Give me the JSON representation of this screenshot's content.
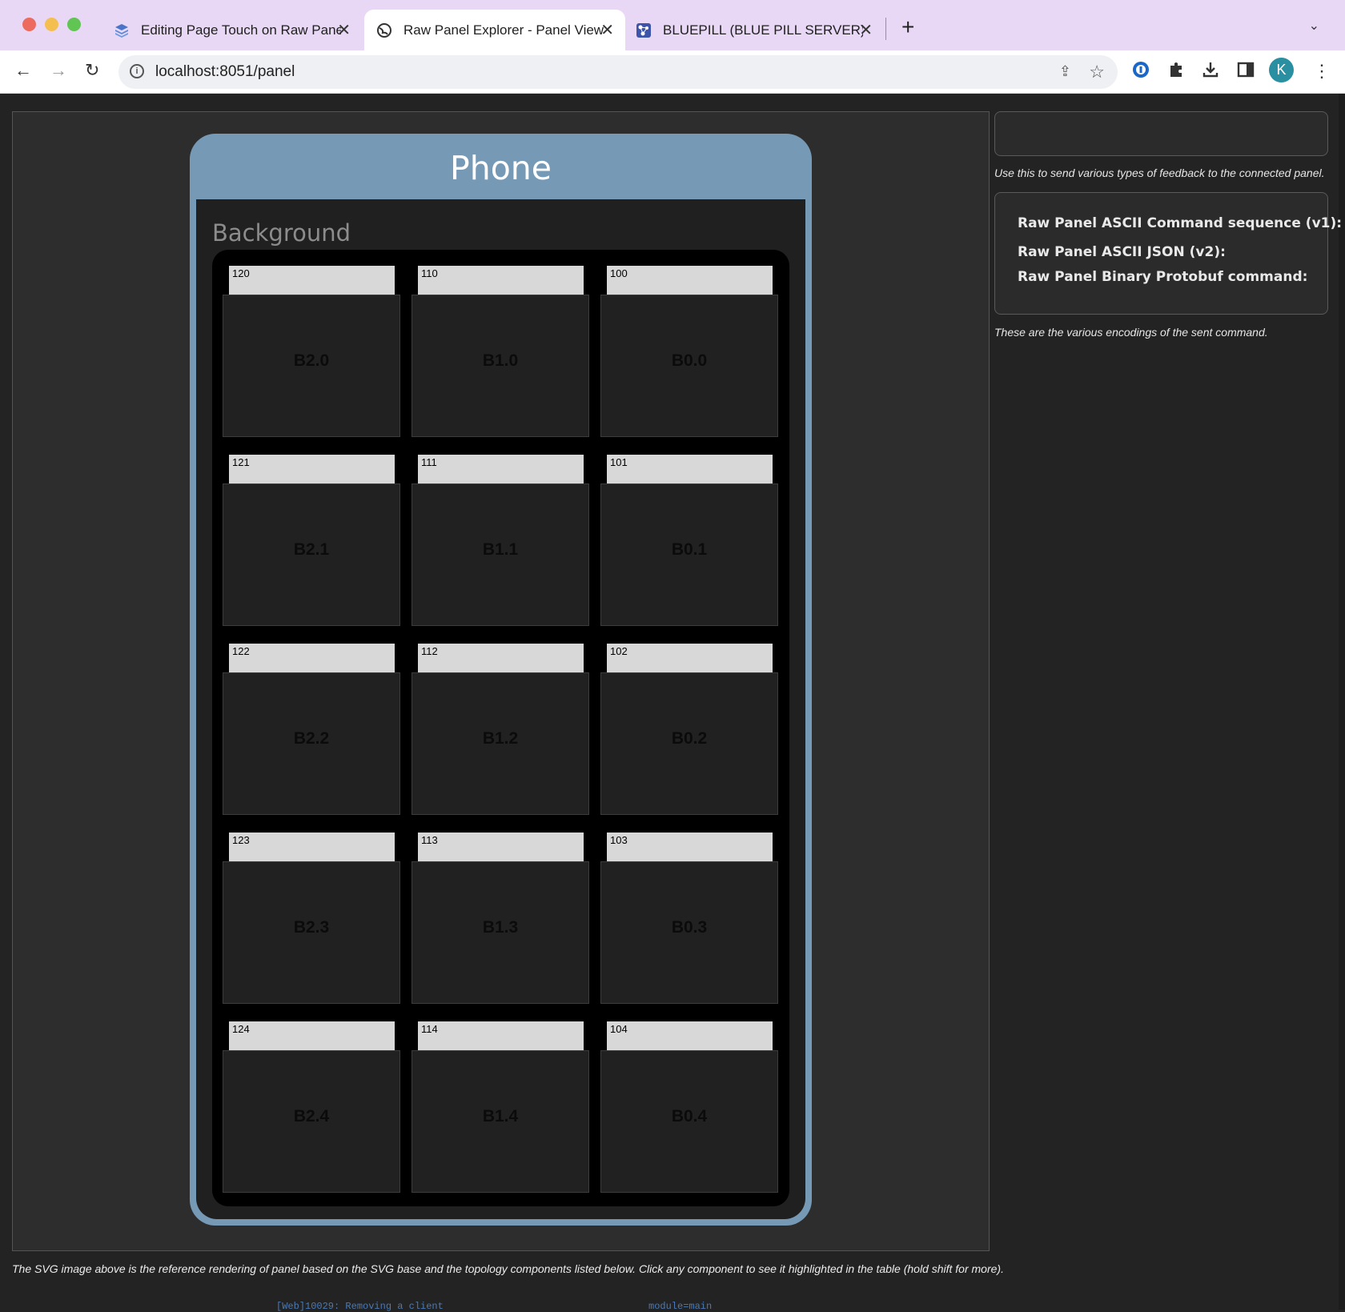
{
  "browser": {
    "tabs": [
      {
        "title": "Editing Page Touch on Raw Panel",
        "active": false
      },
      {
        "title": "Raw Panel Explorer - Panel View",
        "active": true
      },
      {
        "title": "BLUEPILL (BLUE PILL SERVER)",
        "active": false
      }
    ],
    "url": "localhost:8051/panel",
    "profile_initial": "K"
  },
  "panel": {
    "title": "Phone",
    "background_label": "Background",
    "columns": [
      [
        {
          "id": "120",
          "label": "B2.0"
        },
        {
          "id": "121",
          "label": "B2.1"
        },
        {
          "id": "122",
          "label": "B2.2"
        },
        {
          "id": "123",
          "label": "B2.3"
        },
        {
          "id": "124",
          "label": "B2.4"
        }
      ],
      [
        {
          "id": "110",
          "label": "B1.0"
        },
        {
          "id": "111",
          "label": "B1.1"
        },
        {
          "id": "112",
          "label": "B1.2"
        },
        {
          "id": "113",
          "label": "B1.3"
        },
        {
          "id": "114",
          "label": "B1.4"
        }
      ],
      [
        {
          "id": "100",
          "label": "B0.0"
        },
        {
          "id": "101",
          "label": "B0.1"
        },
        {
          "id": "102",
          "label": "B0.2"
        },
        {
          "id": "103",
          "label": "B0.3"
        },
        {
          "id": "104",
          "label": "B0.4"
        }
      ]
    ]
  },
  "sidebar": {
    "feedback_note": "Use this to send various types of feedback to the connected panel.",
    "commands": {
      "ascii_v1": "Raw Panel ASCII Command sequence (v1):",
      "json_v2": "Raw Panel ASCII JSON (v2):",
      "protobuf": "Raw Panel Binary Protobuf command:"
    },
    "encodings_note": "These are the various encodings of the sent command."
  },
  "footer_note": "The SVG image above is the reference rendering of panel based on the SVG base and the topology components listed below. Click any component to see it highlighted in the table (hold shift for more).",
  "underlying_text": {
    "left": "[Web]10029: Removing a client",
    "right": "module=main"
  },
  "colors": {
    "phone_frame": "#7699b6",
    "button_tab": "#d8d8d8",
    "page_bg": "#232323"
  }
}
